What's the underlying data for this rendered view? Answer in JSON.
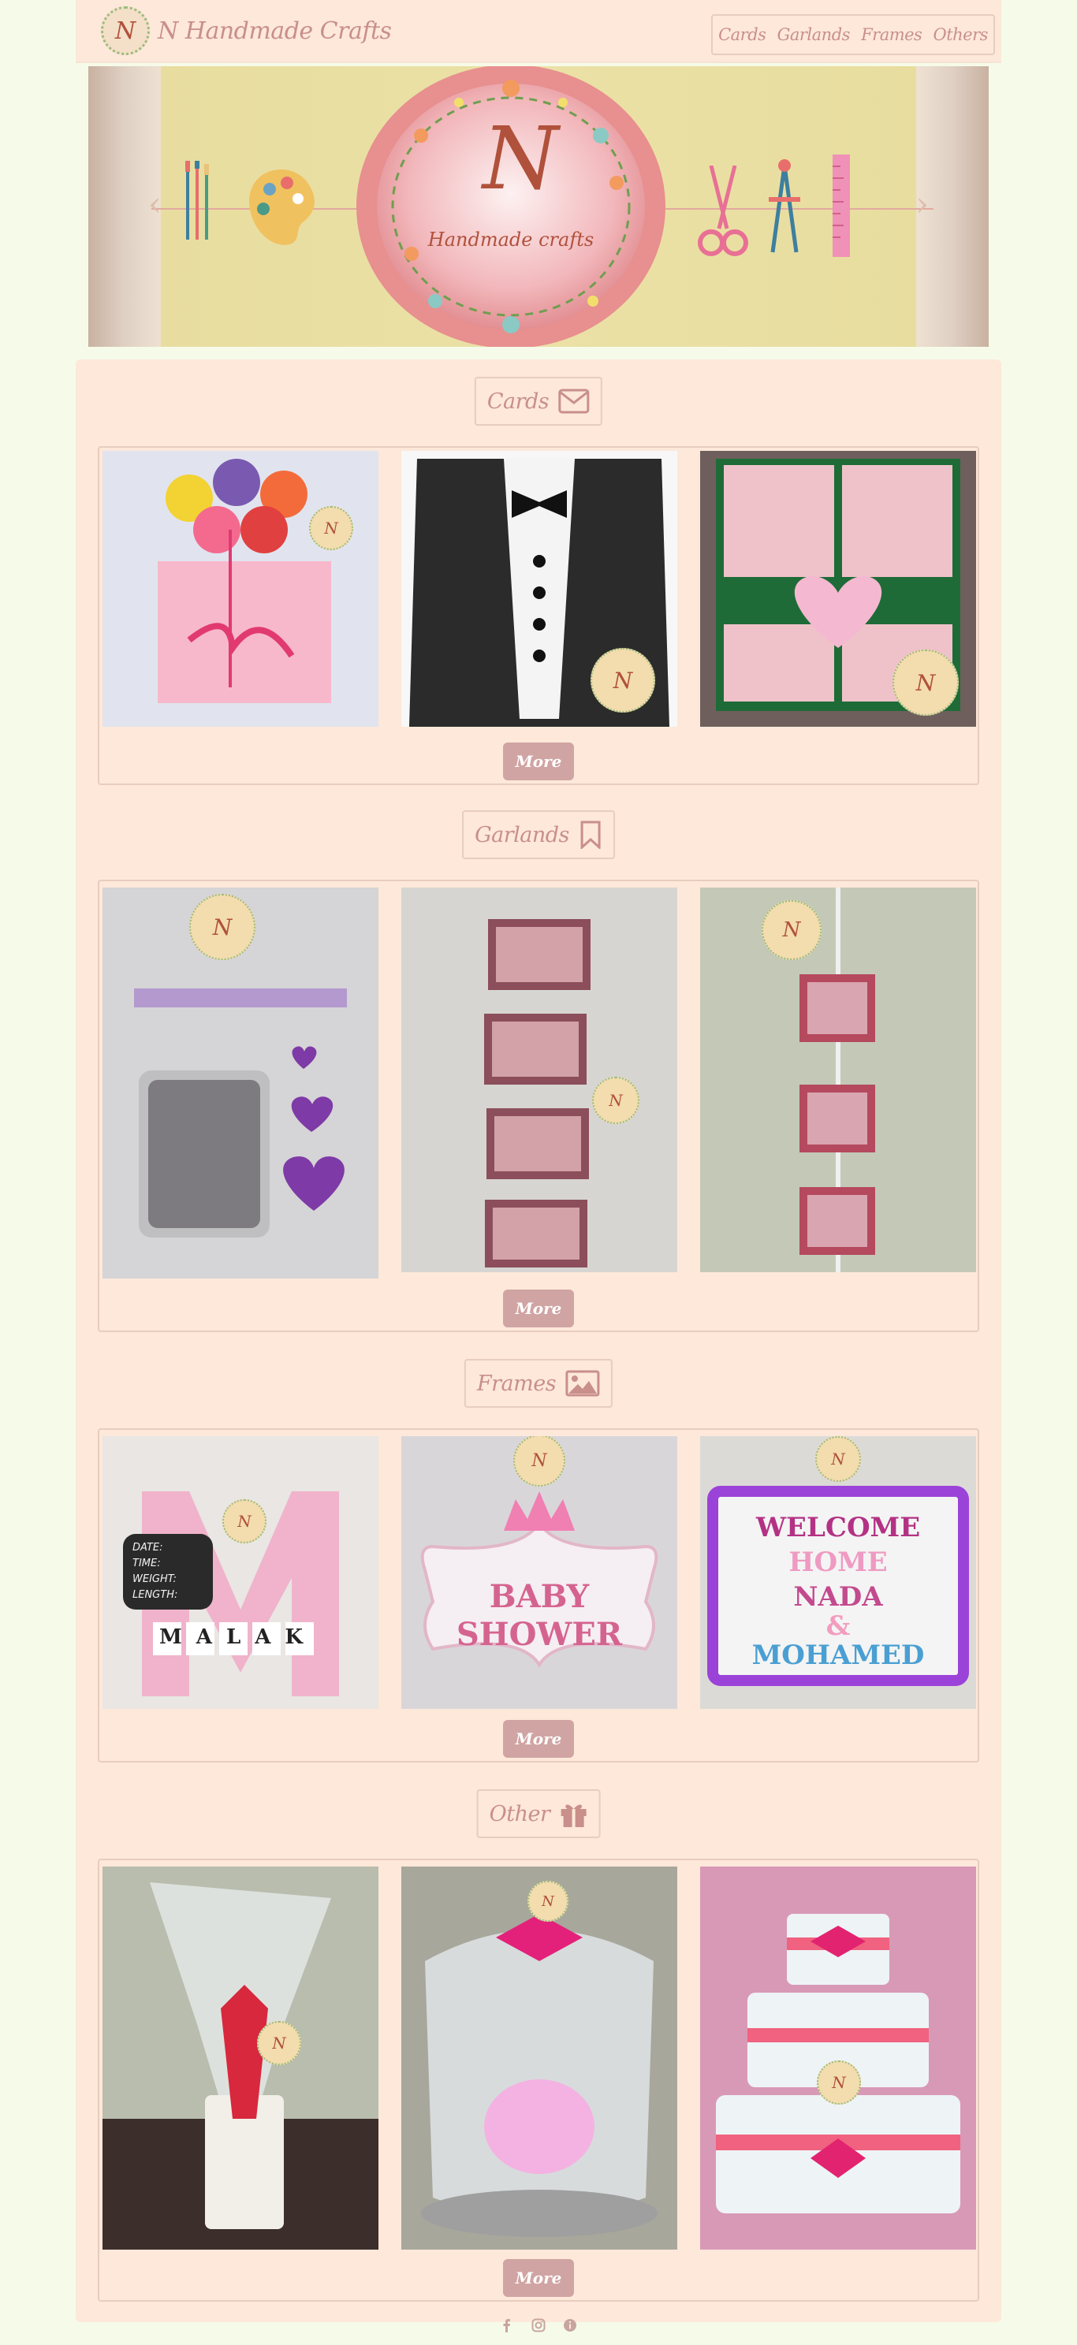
{
  "brand": {
    "logo_letter": "N",
    "name": "N Handmade Crafts"
  },
  "nav": {
    "items": [
      "Cards",
      "Garlands",
      "Frames",
      "Others"
    ]
  },
  "hero": {
    "letter": "N",
    "tagline": "Handmade crafts",
    "prev": "‹",
    "next": "›"
  },
  "sections": [
    {
      "title": "Cards",
      "icon": "envelope-icon",
      "more": "More",
      "photos": [
        "pink-flower-card",
        "tuxedo-card",
        "green-heart-card"
      ]
    },
    {
      "title": "Garlands",
      "icon": "bookmark-icon",
      "more": "More",
      "photos": [
        "heart-frame-garland",
        "photo-strip-garland",
        "popsicle-frame-garland"
      ]
    },
    {
      "title": "Frames",
      "icon": "image-icon",
      "more": "More",
      "photos": [
        "malak-letter-frame",
        "baby-shower-sign",
        "welcome-home-sign"
      ]
    },
    {
      "title": "Other",
      "icon": "gift-icon",
      "more": "More",
      "photos": [
        "gift-mug-wrap",
        "gift-basket",
        "diaper-cake"
      ]
    }
  ],
  "signs": {
    "malak": "MALAK",
    "chalkboard": [
      "DATE:",
      "TIME:",
      "WEIGHT:",
      "LENGTH:"
    ],
    "baby_shower": [
      "BABY",
      "SHOWER"
    ],
    "welcome": [
      "WELCOME",
      "HOME",
      "NADA",
      "&",
      "MOHAMED"
    ]
  },
  "footer": {
    "icons": [
      "facebook-icon",
      "instagram-icon",
      "info-icon"
    ]
  },
  "colors": {
    "page_bg": "#f6fbe9",
    "panel_bg": "#fde8da",
    "accent": "#c98f8a",
    "button": "#d0a4a3"
  }
}
